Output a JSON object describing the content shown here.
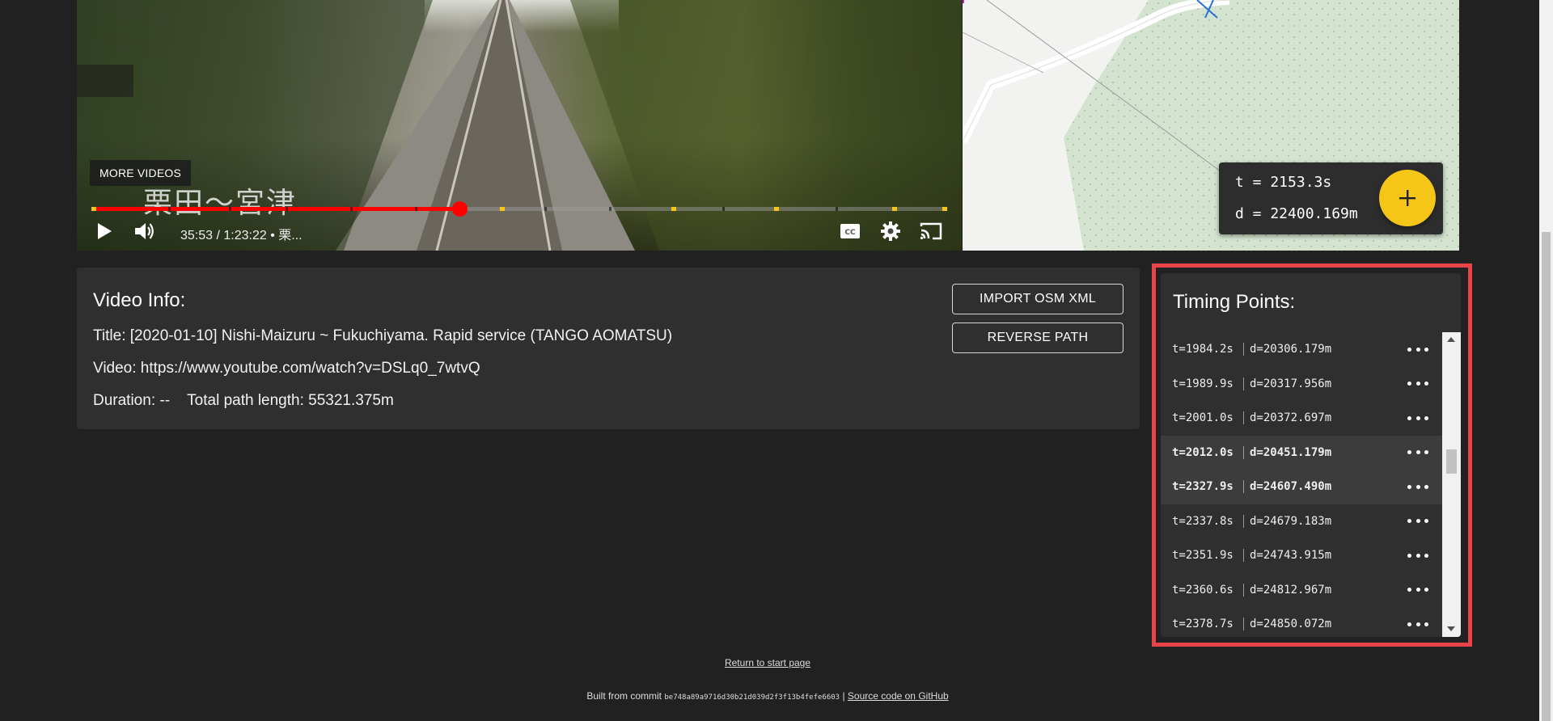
{
  "video": {
    "more_videos_label": "MORE VIDEOS",
    "overlay_text": "栗田～宮津",
    "time_display": "35:53 / 1:23:22 • 栗...",
    "progress_fraction": 0.43,
    "icons": {
      "play": "play-icon",
      "volume": "volume-icon",
      "captions": "captions-icon",
      "settings": "gear-icon",
      "cast": "cast-icon"
    }
  },
  "map_readout": {
    "t_line": "t = 2153.3s",
    "d_line": "d = 22400.169m",
    "add_icon": "plus-icon"
  },
  "video_info": {
    "heading": "Video Info:",
    "title_line": "Title: [2020-01-10] Nishi-Maizuru ~ Fukuchiyama. Rapid service (TANGO AOMATSU)",
    "video_line": "Video: https://www.youtube.com/watch?v=DSLq0_7wtvQ",
    "duration_line": "Duration: --",
    "path_length_line": "Total path length: 55321.375m",
    "import_button": "IMPORT OSM XML",
    "reverse_button": "REVERSE PATH"
  },
  "timing_points": {
    "heading": "Timing Points:",
    "items": [
      {
        "t": "t=1984.2s",
        "d": "d=20306.179m",
        "selected": false
      },
      {
        "t": "t=1989.9s",
        "d": "d=20317.956m",
        "selected": false
      },
      {
        "t": "t=2001.0s",
        "d": "d=20372.697m",
        "selected": false
      },
      {
        "t": "t=2012.0s",
        "d": "d=20451.179m",
        "selected": true
      },
      {
        "t": "t=2327.9s",
        "d": "d=24607.490m",
        "selected": true
      },
      {
        "t": "t=2337.8s",
        "d": "d=24679.183m",
        "selected": false
      },
      {
        "t": "t=2351.9s",
        "d": "d=24743.915m",
        "selected": false
      },
      {
        "t": "t=2360.6s",
        "d": "d=24812.967m",
        "selected": false
      },
      {
        "t": "t=2378.7s",
        "d": "d=24850.072m",
        "selected": false
      }
    ],
    "more_icon": "more-horizontal-icon"
  },
  "footer": {
    "return_link": "Return to start page",
    "built_prefix": "Built from commit",
    "commit_hash": "be748a89a9716d30b21d039d2f3f13b4fefe6603",
    "separator": "|",
    "source_link": "Source code on GitHub"
  },
  "colors": {
    "page_bg": "#212121",
    "card_bg": "#2f2f2f",
    "accent_yellow": "#f5c518",
    "progress_red": "#ff0000",
    "highlight_outline": "#e8444a"
  }
}
